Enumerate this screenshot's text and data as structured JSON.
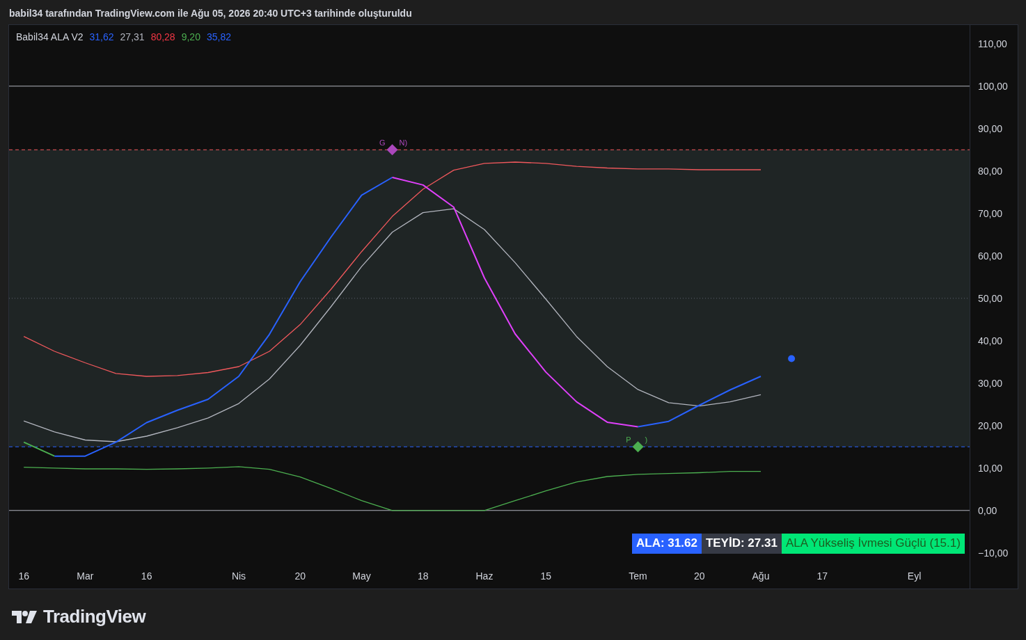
{
  "header": {
    "caption": "babil34 tarafından TradingView.com ile Ağu 05, 2026 20:40 UTC+3 tarihinde oluşturuldu"
  },
  "legend": {
    "title": "Babil34 ALA V2",
    "values": [
      {
        "text": "31,62",
        "color": "#2962ff"
      },
      {
        "text": "27,31",
        "color": "#b2b5be"
      },
      {
        "text": "80,28",
        "color": "#f23645"
      },
      {
        "text": "9,20",
        "color": "#4caf50"
      },
      {
        "text": "35,82",
        "color": "#2962ff"
      }
    ]
  },
  "chart": {
    "chart_data": {
      "type": "line",
      "categories": [
        "16",
        null,
        "Mar",
        null,
        "16",
        null,
        null,
        "Nis",
        null,
        "20",
        null,
        "May",
        null,
        "18",
        null,
        "Haz",
        null,
        "15",
        null,
        null,
        "Tem",
        null,
        "20",
        null,
        "Ağu",
        null,
        "17",
        null,
        null,
        "Eyl",
        null
      ],
      "series": [
        {
          "color": "#f0585c",
          "values": [
            41.0,
            37.5,
            34.8,
            32.3,
            31.6,
            31.8,
            32.5,
            33.9,
            37.5,
            43.8,
            52.1,
            61.0,
            69.3,
            75.7,
            80.2,
            81.8,
            82.1,
            81.8,
            81.1,
            80.7,
            80.5,
            80.5,
            80.3,
            80.3,
            80.3,
            null,
            null,
            null,
            null,
            null,
            null
          ]
        },
        {
          "color": "#b2b5be",
          "values": [
            21.1,
            18.5,
            16.6,
            16.2,
            17.5,
            19.5,
            21.8,
            25.2,
            31.0,
            38.9,
            48.0,
            57.5,
            65.6,
            70.2,
            71.1,
            66.2,
            58.4,
            49.8,
            41.0,
            33.9,
            28.5,
            25.4,
            24.6,
            25.6,
            27.3,
            null,
            null,
            null,
            null,
            null,
            null
          ]
        },
        {
          "color": "#4caf50",
          "values": [
            16.1,
            12.8,
            null,
            null,
            null,
            null,
            null,
            null,
            null,
            null,
            null,
            null,
            null,
            null,
            null,
            null,
            null,
            null,
            null,
            null,
            null,
            null,
            null,
            null,
            null,
            null,
            null,
            null,
            null,
            null,
            null
          ]
        },
        {
          "color": "#2962ff",
          "values": [
            null,
            12.8,
            12.8,
            16.1,
            20.7,
            23.6,
            26.2,
            31.6,
            41.5,
            53.9,
            64.4,
            74.3,
            78.5,
            null,
            null,
            null,
            null,
            null,
            null,
            null,
            19.7,
            21.0,
            24.8,
            28.4,
            31.6,
            null,
            null,
            null,
            null,
            null,
            null
          ]
        },
        {
          "color": "#e040fb",
          "values": [
            null,
            null,
            null,
            null,
            null,
            null,
            null,
            null,
            null,
            null,
            null,
            null,
            78.5,
            76.7,
            71.5,
            54.8,
            41.6,
            32.6,
            25.6,
            20.8,
            19.7,
            null,
            null,
            null,
            null,
            null,
            null,
            null,
            null,
            null,
            null
          ]
        },
        {
          "color": "#4caf50",
          "values": [
            10.2,
            10.0,
            9.8,
            9.8,
            9.7,
            9.8,
            10.0,
            10.3,
            9.7,
            7.9,
            5.2,
            2.3,
            0,
            0,
            0,
            0,
            2.3,
            4.6,
            6.7,
            8.0,
            8.5,
            8.7,
            8.9,
            9.2,
            9.2,
            null,
            null,
            null,
            null,
            null,
            null
          ]
        },
        {
          "color": "#2962ff",
          "marker": true,
          "values": [
            null,
            null,
            null,
            null,
            null,
            null,
            null,
            null,
            null,
            null,
            null,
            null,
            null,
            null,
            null,
            null,
            null,
            null,
            null,
            null,
            null,
            null,
            null,
            null,
            null,
            35.8,
            null,
            null,
            null,
            null,
            null
          ]
        }
      ],
      "ylim": [
        -18.4,
        114.4
      ],
      "ref_lines": [
        {
          "axis": "y",
          "value": 100
        },
        {
          "axis": "y",
          "value": 85
        },
        {
          "axis": "y",
          "value": 50
        },
        {
          "axis": "y",
          "value": 15
        },
        {
          "axis": "y",
          "value": 0
        }
      ],
      "annotations": [
        "G",
        "N)",
        "P",
        ")"
      ],
      "yticks": [
        {
          "value": 110,
          "label": "110,00"
        },
        {
          "value": 100,
          "label": "100,00"
        },
        {
          "value": 90,
          "label": "90,00"
        },
        {
          "value": 80,
          "label": "80,00"
        },
        {
          "value": 70,
          "label": "70,00"
        },
        {
          "value": 60,
          "label": "60,00"
        },
        {
          "value": 50,
          "label": "50,00"
        },
        {
          "value": 40,
          "label": "40,00"
        },
        {
          "value": 30,
          "label": "30,00"
        },
        {
          "value": 20,
          "label": "20,00"
        },
        {
          "value": 10,
          "label": "10,00"
        },
        {
          "value": 0,
          "label": "0,00"
        },
        {
          "value": -10,
          "label": "−10,00"
        }
      ]
    },
    "markers": [
      {
        "color": "#ab47bc"
      },
      {
        "color": "#4caf50"
      }
    ]
  },
  "status": [
    {
      "text": "ALA: 31.62",
      "color": "#2962ff"
    },
    {
      "text": "TEYİD: 27.31",
      "color": "#363a45"
    },
    {
      "text": "ALA Yükseliş İvmesi Güçlü (15.1)",
      "color": "#00e676"
    }
  ],
  "footer": {
    "brand": "TradingView"
  }
}
